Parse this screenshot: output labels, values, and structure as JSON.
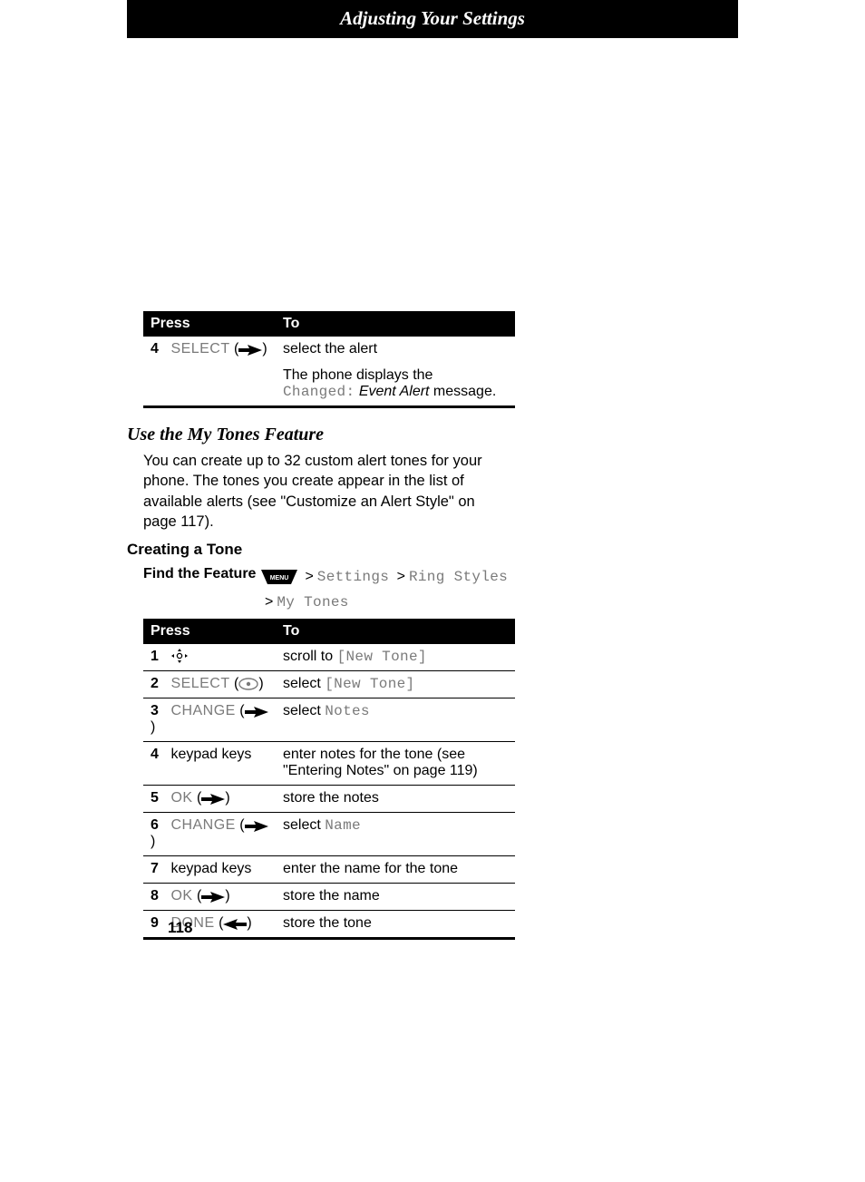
{
  "page_title": "Adjusting Your Settings",
  "table1": {
    "head_press": "Press",
    "head_to": "To",
    "rows": [
      {
        "num": "4",
        "key": "SELECT",
        "icon": "right-softkey",
        "to": "select the alert",
        "note_prefix": "The phone displays the ",
        "note_mono": "Changed:",
        "note_italic": " Event Alert",
        "note_suffix": " message."
      }
    ]
  },
  "section_title": "Use the My Tones Feature",
  "section_body": "You can create up to 32 custom alert tones for your phone. The tones you create appear in the list of available alerts (see \"Customize an Alert Style\" on page 117).",
  "subheading": "Creating a Tone",
  "find_feature_label": "Find the Feature",
  "nav": {
    "badge": "MENU",
    "p1": "Settings",
    "p2": "Ring Styles",
    "p3": "My Tones"
  },
  "table2": {
    "head_press": "Press",
    "head_to": "To",
    "rows": [
      {
        "num": "1",
        "icon": "nav-4way",
        "key": "",
        "to_pre": "scroll to ",
        "to_mono": "[New Tone]"
      },
      {
        "num": "2",
        "key": "SELECT",
        "icon": "center-select",
        "to_pre": "select ",
        "to_mono": "[New Tone]"
      },
      {
        "num": "3",
        "key": "CHANGE",
        "icon": "right-softkey",
        "to_pre": "select ",
        "to_mono": "Notes"
      },
      {
        "num": "4",
        "key": "keypad keys",
        "icon": "",
        "to_pre": "enter notes for the tone (see \"Entering Notes\" on page 119)",
        "to_mono": ""
      },
      {
        "num": "5",
        "key": "OK",
        "icon": "right-softkey",
        "to_pre": "store the notes",
        "to_mono": ""
      },
      {
        "num": "6",
        "key": "CHANGE",
        "icon": "right-softkey",
        "to_pre": "select ",
        "to_mono": "Name"
      },
      {
        "num": "7",
        "key": "keypad keys",
        "icon": "",
        "to_pre": "enter the name for the tone",
        "to_mono": ""
      },
      {
        "num": "8",
        "key": "OK",
        "icon": "right-softkey",
        "to_pre": "store the name",
        "to_mono": ""
      },
      {
        "num": "9",
        "key": "DONE",
        "icon": "left-softkey",
        "to_pre": "store the tone",
        "to_mono": ""
      }
    ]
  },
  "page_number": "118"
}
